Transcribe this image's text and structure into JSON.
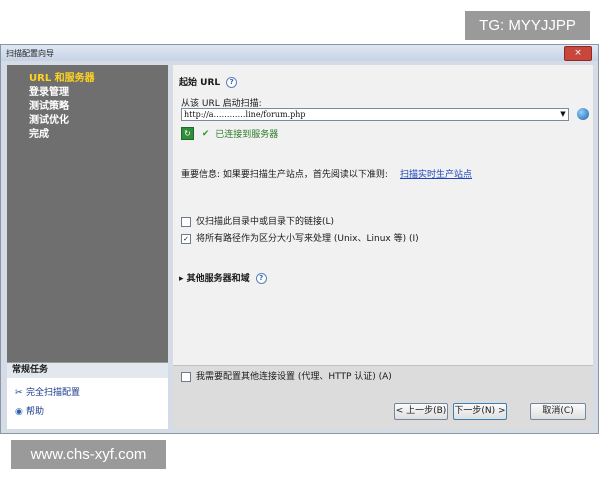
{
  "watermarks": {
    "top": "TG: MYYJJPP",
    "bottom": "www.chs-xyf.com"
  },
  "window": {
    "title": "扫描配置向导",
    "close": "×"
  },
  "sidebar": {
    "nav": [
      {
        "label": "URL 和服务器",
        "active": true
      },
      {
        "label": "登录管理"
      },
      {
        "label": "测试策略"
      },
      {
        "label": "测试优化"
      },
      {
        "label": "完成"
      }
    ],
    "tasks_title": "常规任务",
    "tasks": [
      {
        "label": "完全扫描配置",
        "icon": "tools-icon"
      },
      {
        "label": "帮助",
        "icon": "help-icon"
      }
    ]
  },
  "main": {
    "section_title": "起始 URL",
    "url_label": "从该 URL 启动扫描:",
    "url_value": "http://a…………line/forum.php",
    "status": "已连接到服务器",
    "notice": "重要信息: 如果要扫描生产站点，首先阅读以下准则:",
    "notice_link": "扫描实时生产站点",
    "checkbox1": "仅扫描此目录中或目录下的链接(L)",
    "checkbox2": "将所有路径作为区分大小写来处理 (Unix、Linux 等) (I)",
    "expander": "其他服务器和域",
    "connection_checkbox": "我需要配置其他连接设置 (代理、HTTP 认证) (A)"
  },
  "buttons": {
    "back": "< 上一步(B)",
    "next": "下一步(N) >",
    "cancel": "取消(C)"
  },
  "colors": {
    "sidebar_bg": "#6f6f6f",
    "active_nav": "#ffd21e",
    "link": "#1c44b8"
  }
}
